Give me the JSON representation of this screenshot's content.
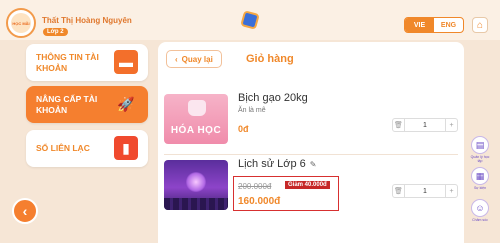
{
  "header": {
    "logo_text": "HỌC MÃI",
    "user_name": "Thất  Thị Hoàng Nguyên",
    "grade": "Lớp 2",
    "lang_vie": "VIE",
    "lang_eng": "ENG",
    "home_icon": "home-icon",
    "center_icon": "app-logo-icon"
  },
  "menu": [
    {
      "label": "THÔNG TIN TÀI KHOẢN",
      "icon": "folder-icon",
      "active": false
    },
    {
      "label": "NÂNG CẤP TÀI KHOẢN",
      "icon": "rocket-icon",
      "active": true
    },
    {
      "label": "SỔ LIÊN LẠC",
      "icon": "book-icon",
      "active": false
    }
  ],
  "cart": {
    "back_label": "Quay lại",
    "title": "Giỏ hàng",
    "items": [
      {
        "name": "Bịch gạo 20kg",
        "subtitle": "Ăn là mê",
        "thumb_text": "HÓA HỌC",
        "price": "0đ",
        "quantity": "1"
      },
      {
        "name": "Lịch sử Lớp 6",
        "edit_icon": "pencil-icon",
        "old_price": "200.000đ",
        "discount": "Giảm 40.000đ",
        "price": "160.000đ",
        "quantity": "1"
      }
    ]
  },
  "side_buttons": [
    {
      "label": "Quản lý học tập",
      "icon": "chart-icon"
    },
    {
      "label": "Sự kiện",
      "icon": "calendar-icon"
    },
    {
      "label": "Chăm sóc",
      "icon": "support-icon"
    }
  ],
  "colors": {
    "accent": "#f0882a",
    "active_menu": "#f57f2f",
    "discount_red": "#c62828",
    "background": "#f6e6d6"
  }
}
